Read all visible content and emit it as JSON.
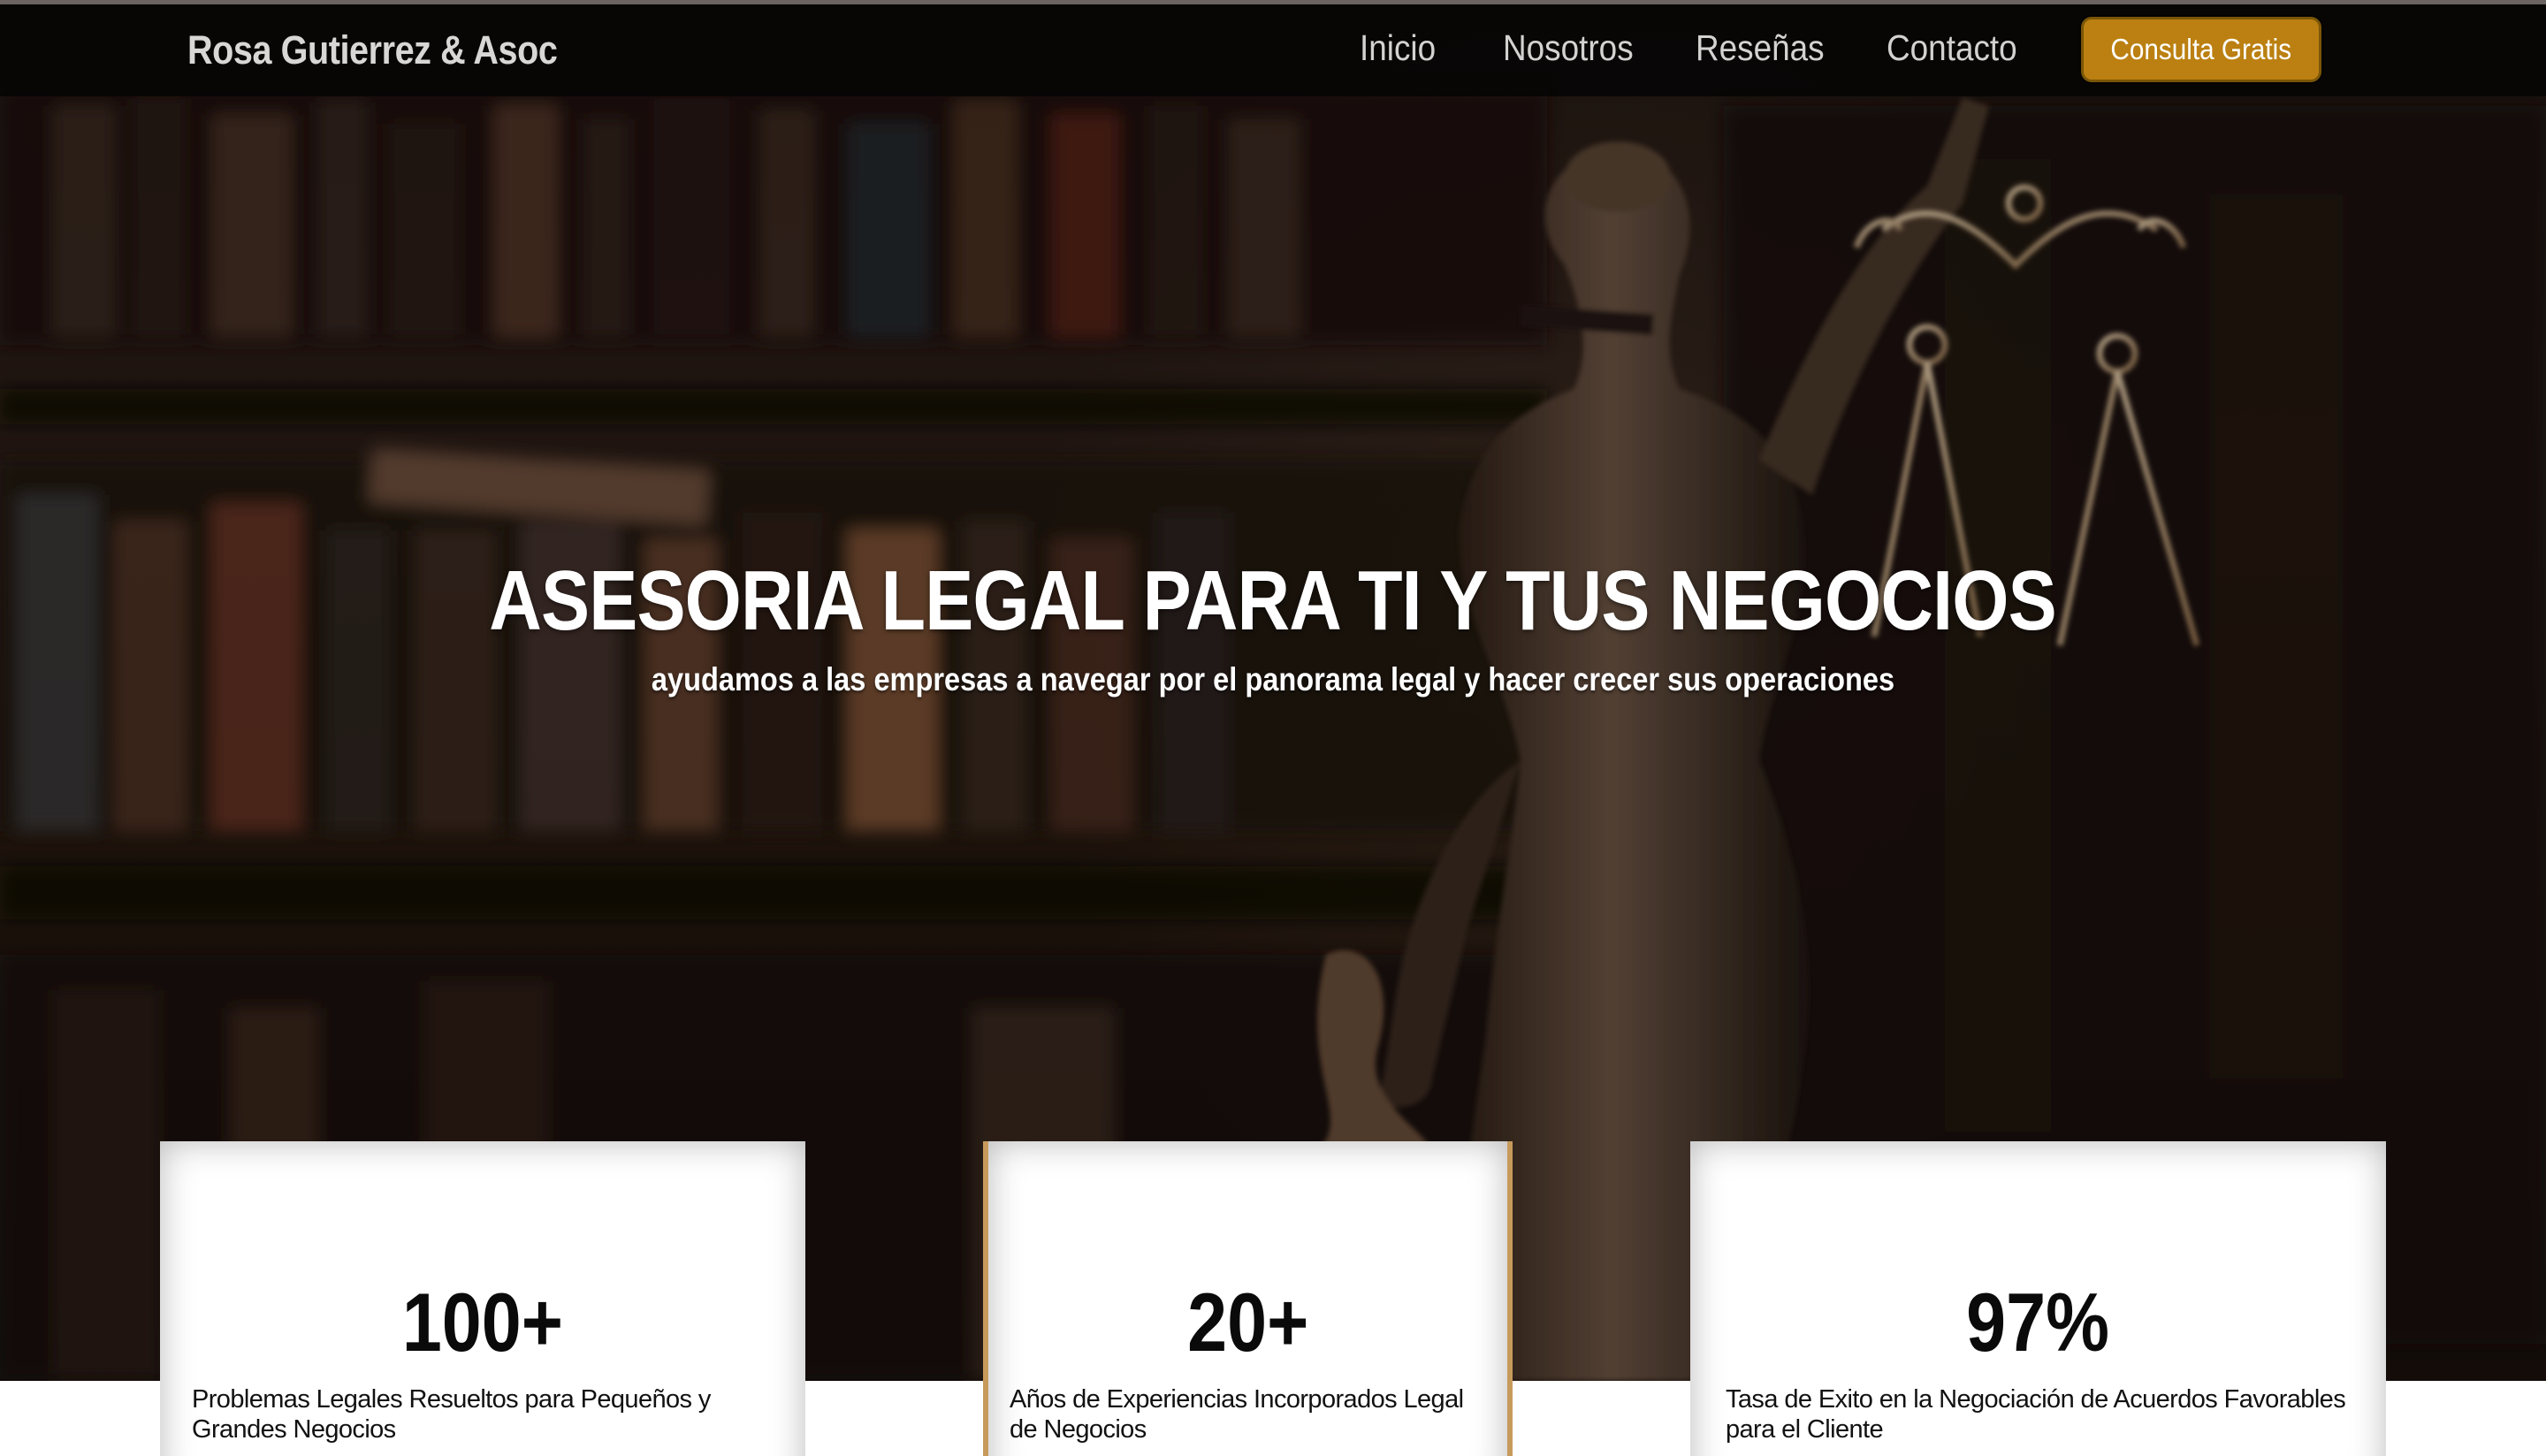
{
  "navbar": {
    "brand": "Rosa Gutierrez & Asoc",
    "links": [
      "Inicio",
      "Nosotros",
      "Reseñas",
      "Contacto"
    ],
    "cta_label": "Consulta Gratis"
  },
  "hero": {
    "title": "ASESORIA LEGAL PARA TI Y TUS NEGOCIOS",
    "subtitle": "ayudamos a las empresas a navegar por el panorama legal y hacer crecer sus operaciones"
  },
  "stats": [
    {
      "value": "100+",
      "label": "Problemas Legales Resueltos para Pequeños y Grandes Negocios"
    },
    {
      "value": "20+",
      "label": "Años de Experiencias Incorporados Legal de Negocios"
    },
    {
      "value": "97%",
      "label": "Tasa de Exito en la Negociación de Acuerdos Favorables para el Cliente"
    }
  ],
  "colors": {
    "accent": "#bb8011",
    "navbar_bg": "#060404",
    "hero_bg": "#2a1c17",
    "card_accent_border": "#c79a5c"
  }
}
